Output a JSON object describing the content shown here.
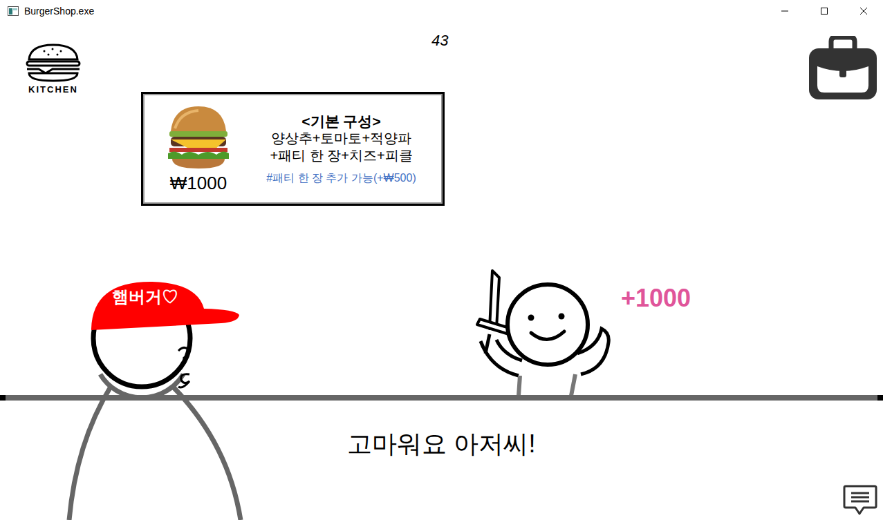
{
  "window": {
    "title": "BurgerShop.exe"
  },
  "hud": {
    "timer": "43",
    "kitchen_label": "KITCHEN"
  },
  "menu_card": {
    "price": "₩1000",
    "heading": "<기본 구성>",
    "lines": [
      "양상추+토마토+적양파",
      "+패티 한 장+치즈+피클"
    ],
    "option": "#패티 한 장 추가 가능(+₩500)"
  },
  "player": {
    "cap_text": "햄버거♡"
  },
  "customer": {
    "earned": "+1000"
  },
  "dialogue": {
    "text": "고마워요 아저씨!"
  }
}
